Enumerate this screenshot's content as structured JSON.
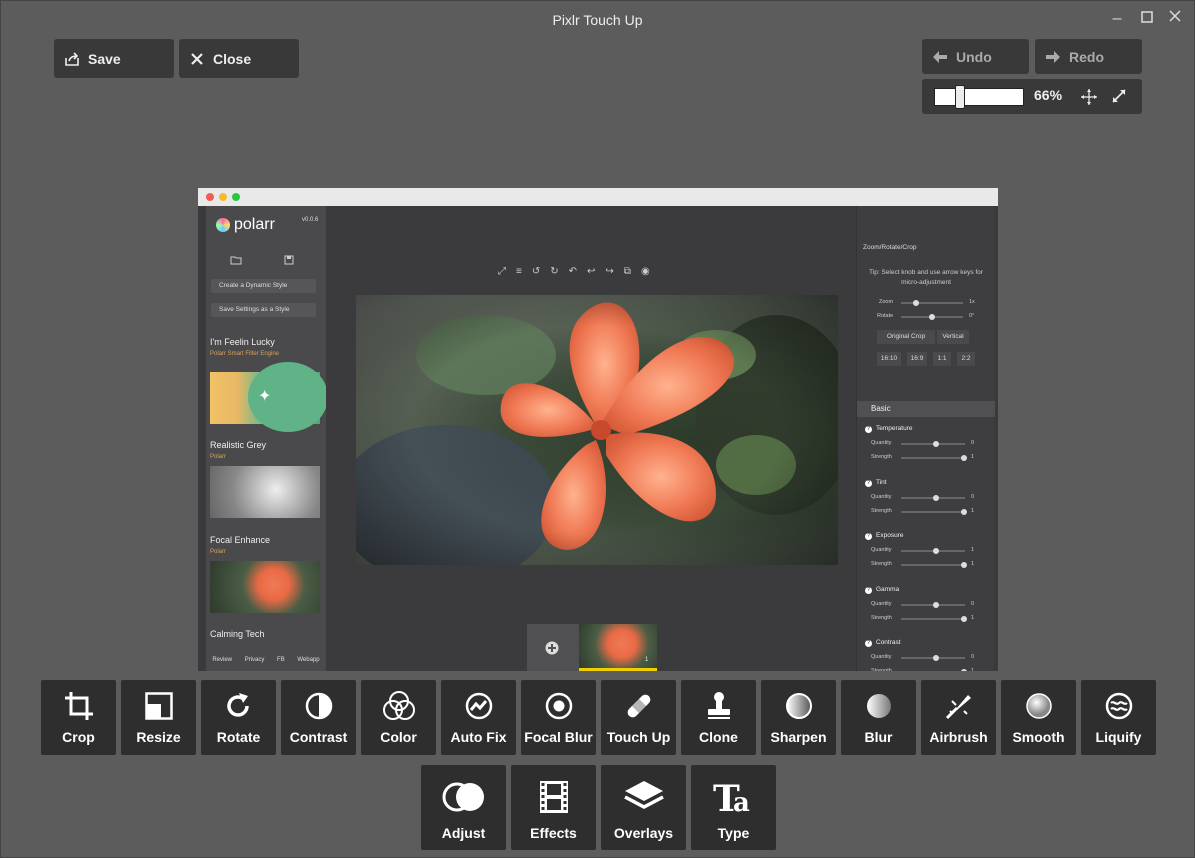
{
  "window": {
    "title": "Pixlr Touch Up",
    "controls": [
      "minimize-icon",
      "maximize-icon",
      "close-icon"
    ]
  },
  "header": {
    "save_label": "Save",
    "close_label": "Close",
    "undo_label": "Undo",
    "redo_label": "Redo",
    "zoom_value": "66%",
    "zoom_level": 0.25
  },
  "embedded_app": {
    "logo_text": "polarr",
    "version": "v0.0.6",
    "create_style_label": "Create a Dynamic Style",
    "save_settings_label": "Save Settings as a Style",
    "styles": [
      {
        "title": "I'm Feelin Lucky",
        "subtitle": "Polarr Smart Filter Engine"
      },
      {
        "title": "Realistic Grey",
        "subtitle": "Polarr"
      },
      {
        "title": "Focal Enhance",
        "subtitle": "Polarr"
      },
      {
        "title": "Calming Tech",
        "subtitle": ""
      }
    ],
    "footer_links": [
      "Review",
      "Privacy",
      "FB",
      "Webapp"
    ],
    "film_count": "1",
    "right_panel": {
      "header": "Zoom/Rotate/Crop",
      "tip": "Tip: Select knob and use arrow keys for micro-adjustment",
      "zoom_label": "Zoom",
      "zoom_value": "1x",
      "rotate_label": "Rotate",
      "rotate_value": "0°",
      "original_crop": "Original Crop",
      "vertical": "Vertical",
      "ratios": [
        "16:10",
        "16:9",
        "1:1",
        "2:2"
      ],
      "basic_label": "Basic",
      "sections": [
        {
          "name": "Temperature",
          "quantity": "0",
          "strength": "1"
        },
        {
          "name": "Tint",
          "quantity": "0",
          "strength": "1"
        },
        {
          "name": "Exposure",
          "quantity": "1",
          "strength": "1"
        },
        {
          "name": "Gamma",
          "quantity": "0",
          "strength": "1"
        },
        {
          "name": "Contrast",
          "quantity": "0",
          "strength": "1"
        }
      ],
      "quantity_label": "Quantity",
      "strength_label": "Strength"
    }
  },
  "tools": [
    {
      "label": "Crop",
      "icon": "crop-icon"
    },
    {
      "label": "Resize",
      "icon": "resize-icon"
    },
    {
      "label": "Rotate",
      "icon": "rotate-icon"
    },
    {
      "label": "Contrast",
      "icon": "contrast-icon"
    },
    {
      "label": "Color",
      "icon": "color-icon"
    },
    {
      "label": "Auto Fix",
      "icon": "auto-fix-icon"
    },
    {
      "label": "Focal Blur",
      "icon": "focal-blur-icon"
    },
    {
      "label": "Touch Up",
      "icon": "bandage-icon"
    },
    {
      "label": "Clone",
      "icon": "stamp-icon"
    },
    {
      "label": "Sharpen",
      "icon": "sharpen-icon"
    },
    {
      "label": "Blur",
      "icon": "blur-icon"
    },
    {
      "label": "Airbrush",
      "icon": "airbrush-icon"
    },
    {
      "label": "Smooth",
      "icon": "smooth-icon"
    },
    {
      "label": "Liquify",
      "icon": "liquify-icon"
    }
  ],
  "categories": [
    {
      "label": "Adjust",
      "icon": "adjust-icon"
    },
    {
      "label": "Effects",
      "icon": "film-icon"
    },
    {
      "label": "Overlays",
      "icon": "layers-icon"
    },
    {
      "label": "Type",
      "icon": "type-icon"
    }
  ],
  "colors": {
    "background": "#5c5c5c",
    "button": "#393939",
    "tool": "#2e2e2e",
    "accent_flower": "#f07a55",
    "style_subtitle": "#d9a15a"
  }
}
